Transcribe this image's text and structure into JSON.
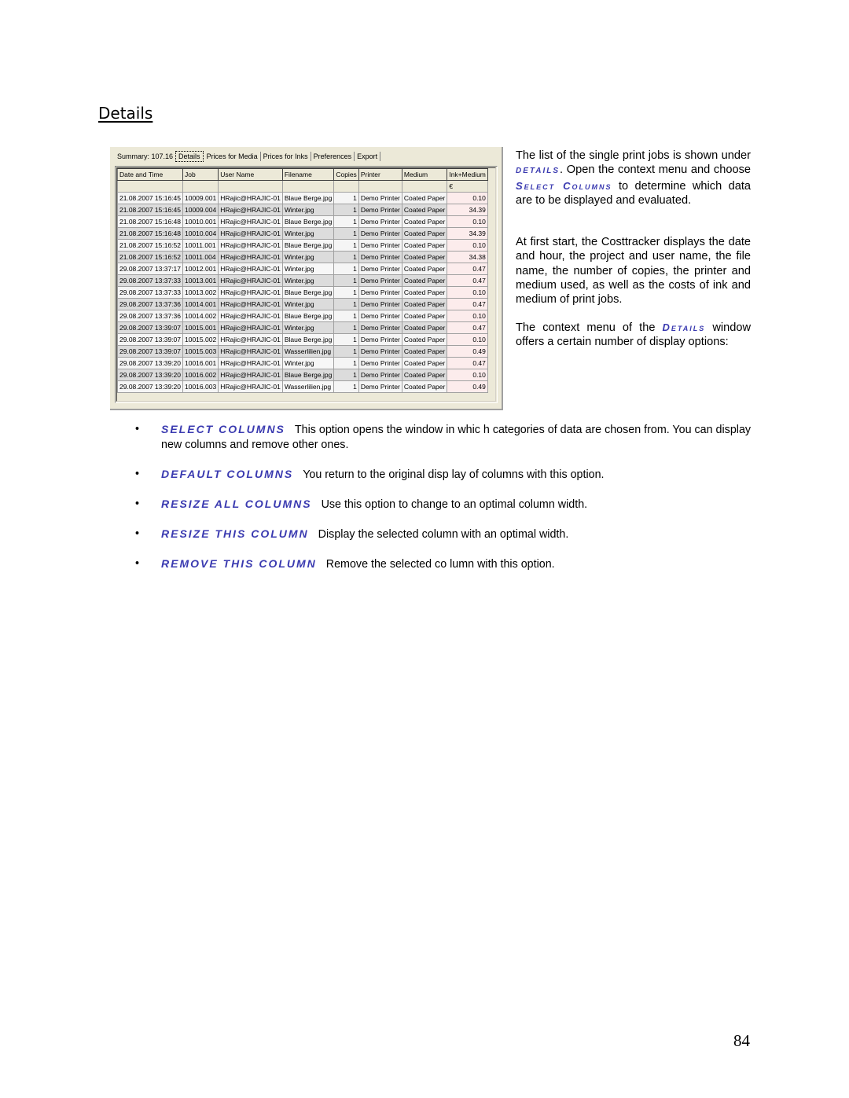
{
  "heading": "Details",
  "screenshot": {
    "tabs": [
      {
        "label": "Summary: 107.16",
        "active": false
      },
      {
        "label": "Details",
        "active": true
      },
      {
        "label": "Prices for Media",
        "active": false
      },
      {
        "label": "Prices for Inks",
        "active": false
      },
      {
        "label": "Preferences",
        "active": false
      },
      {
        "label": "Export",
        "active": false
      }
    ],
    "columns": [
      "Date and Time",
      "Job",
      "User Name",
      "Filename",
      "Copies",
      "Printer",
      "Medium",
      "Ink+Medium"
    ],
    "units": [
      "",
      "",
      "",
      "",
      "",
      "",
      "",
      "€"
    ],
    "rows": [
      [
        "21.08.2007 15:16:45",
        "10009.001",
        "HRajic@HRAJIC-01",
        "Blaue Berge.jpg",
        "1",
        "Demo Printer",
        "Coated Paper",
        "0.10"
      ],
      [
        "21.08.2007 15:16:45",
        "10009.004",
        "HRajic@HRAJIC-01",
        "Winter.jpg",
        "1",
        "Demo Printer",
        "Coated Paper",
        "34.39"
      ],
      [
        "21.08.2007 15:16:48",
        "10010.001",
        "HRajic@HRAJIC-01",
        "Blaue Berge.jpg",
        "1",
        "Demo Printer",
        "Coated Paper",
        "0.10"
      ],
      [
        "21.08.2007 15:16:48",
        "10010.004",
        "HRajic@HRAJIC-01",
        "Winter.jpg",
        "1",
        "Demo Printer",
        "Coated Paper",
        "34.39"
      ],
      [
        "21.08.2007 15:16:52",
        "10011.001",
        "HRajic@HRAJIC-01",
        "Blaue Berge.jpg",
        "1",
        "Demo Printer",
        "Coated Paper",
        "0.10"
      ],
      [
        "21.08.2007 15:16:52",
        "10011.004",
        "HRajic@HRAJIC-01",
        "Winter.jpg",
        "1",
        "Demo Printer",
        "Coated Paper",
        "34.38"
      ],
      [
        "29.08.2007 13:37:17",
        "10012.001",
        "HRajic@HRAJIC-01",
        "Winter.jpg",
        "1",
        "Demo Printer",
        "Coated Paper",
        "0.47"
      ],
      [
        "29.08.2007 13:37:33",
        "10013.001",
        "HRajic@HRAJIC-01",
        "Winter.jpg",
        "1",
        "Demo Printer",
        "Coated Paper",
        "0.47"
      ],
      [
        "29.08.2007 13:37:33",
        "10013.002",
        "HRajic@HRAJIC-01",
        "Blaue Berge.jpg",
        "1",
        "Demo Printer",
        "Coated Paper",
        "0.10"
      ],
      [
        "29.08.2007 13:37:36",
        "10014.001",
        "HRajic@HRAJIC-01",
        "Winter.jpg",
        "1",
        "Demo Printer",
        "Coated Paper",
        "0.47"
      ],
      [
        "29.08.2007 13:37:36",
        "10014.002",
        "HRajic@HRAJIC-01",
        "Blaue Berge.jpg",
        "1",
        "Demo Printer",
        "Coated Paper",
        "0.10"
      ],
      [
        "29.08.2007 13:39:07",
        "10015.001",
        "HRajic@HRAJIC-01",
        "Winter.jpg",
        "1",
        "Demo Printer",
        "Coated Paper",
        "0.47"
      ],
      [
        "29.08.2007 13:39:07",
        "10015.002",
        "HRajic@HRAJIC-01",
        "Blaue Berge.jpg",
        "1",
        "Demo Printer",
        "Coated Paper",
        "0.10"
      ],
      [
        "29.08.2007 13:39:07",
        "10015.003",
        "HRajic@HRAJIC-01",
        "Wasserlilien.jpg",
        "1",
        "Demo Printer",
        "Coated Paper",
        "0.49"
      ],
      [
        "29.08.2007 13:39:20",
        "10016.001",
        "HRajic@HRAJIC-01",
        "Winter.jpg",
        "1",
        "Demo Printer",
        "Coated Paper",
        "0.47"
      ],
      [
        "29.08.2007 13:39:20",
        "10016.002",
        "HRajic@HRAJIC-01",
        "Blaue Berge.jpg",
        "1",
        "Demo Printer",
        "Coated Paper",
        "0.10"
      ],
      [
        "29.08.2007 13:39:20",
        "10016.003",
        "HRajic@HRAJIC-01",
        "Wasserlilien.jpg",
        "1",
        "Demo Printer",
        "Coated Paper",
        "0.49"
      ]
    ]
  },
  "side": {
    "p1": {
      "a": "The list of the single print jobs is shown under ",
      "kw1": "Details",
      "b": ". Open the context menu and choose ",
      "kw2": "Select Columns",
      "c": " to determine which data are to be displayed and evaluated."
    },
    "p2": "At first start, the Costtracker displays the date and hour, the project and user name, the file name, the number of copies, the printer and medium used, as well as the costs of ink and medium of print jobs.",
    "p3": {
      "a": "The context menu of the ",
      "kw": "Details",
      "b": " window offers a certain number of display options:"
    }
  },
  "bullets": [
    {
      "keyword": "SELECT COLUMNS",
      "text": "This option opens the window in whic h categories of data are chosen from. You can display new columns and remove other ones."
    },
    {
      "keyword": "DEFAULT COLUMNS",
      "text": "You return to the original disp lay of columns with this option."
    },
    {
      "keyword": "RESIZE ALL COLUMNS",
      "text": "Use this option to change to an optimal column width."
    },
    {
      "keyword": "RESIZE THIS COLUMN",
      "text": "Display the selected column with an optimal width."
    },
    {
      "keyword": "REMOVE THIS COLUMN",
      "text": "Remove the selected co lumn with this option."
    }
  ],
  "bullet_glyph": "•",
  "page_number": "84",
  "colors": {
    "keyword": "#3a3ab0",
    "cost_cell": "#fcecec",
    "window_bg": "#ece9d8"
  }
}
